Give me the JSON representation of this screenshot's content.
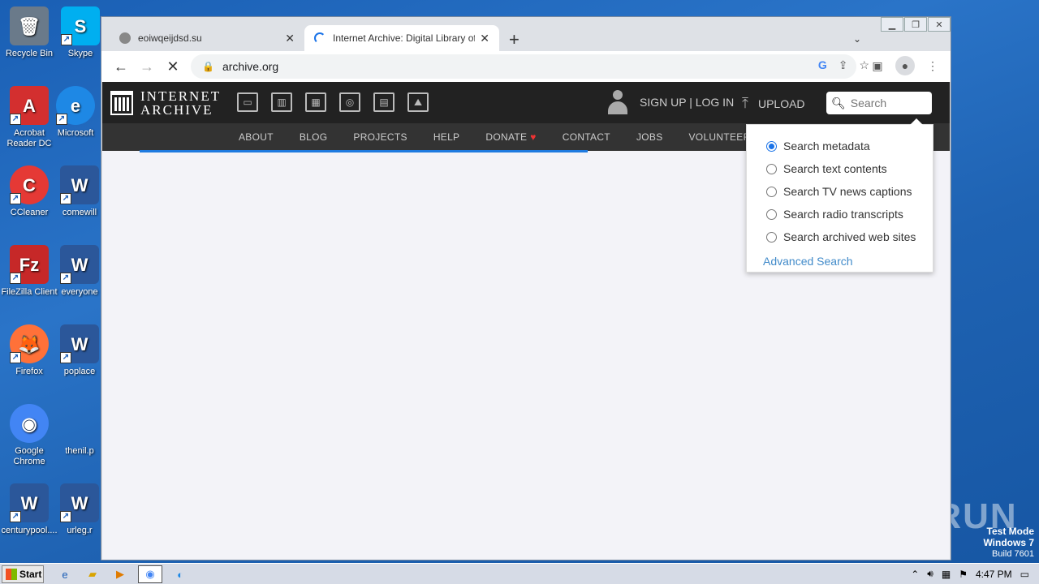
{
  "desktop": {
    "icons": [
      {
        "label": "Recycle Bin",
        "color": "#6a7a8a",
        "glyph": "🗑"
      },
      {
        "label": "Skype",
        "color": "#00aff0",
        "glyph": "S"
      },
      {
        "label": "Acrobat Reader DC",
        "color": "#d32f2f",
        "glyph": "A"
      },
      {
        "label": "Microsoft",
        "color": "#1e88e5",
        "glyph": "e"
      },
      {
        "label": "CCleaner",
        "color": "#e53935",
        "glyph": "C"
      },
      {
        "label": "comewill",
        "color": "#2b579a",
        "glyph": "W"
      },
      {
        "label": "FileZilla Client",
        "color": "#c62828",
        "glyph": "Fz"
      },
      {
        "label": "everyone",
        "color": "#2b579a",
        "glyph": "W"
      },
      {
        "label": "Firefox",
        "color": "#ff7139",
        "glyph": "🦊"
      },
      {
        "label": "poplace",
        "color": "#2b579a",
        "glyph": "W"
      },
      {
        "label": "Google Chrome",
        "color": "#4285f4",
        "glyph": "◉"
      },
      {
        "label": "thenil.p",
        "color": "#2b6cb0",
        "glyph": ""
      },
      {
        "label": "centurypool....",
        "color": "#2b579a",
        "glyph": "W"
      },
      {
        "label": "urleg.r",
        "color": "#2b579a",
        "glyph": "W"
      }
    ],
    "watermark": "ANY RUN",
    "test_mode": {
      "line1": "Test Mode",
      "line2": "Windows 7",
      "line3": "Build 7601"
    }
  },
  "browser": {
    "tabs": [
      {
        "title": "eoiwqeijdsd.su",
        "close": "✕"
      },
      {
        "title": "Internet Archive: Digital Library of Fr",
        "close": "✕"
      }
    ],
    "new_tab": "+",
    "url": "archive.org"
  },
  "ia": {
    "logo_line1": "INTERNET",
    "logo_line2": "ARCHIVE",
    "account": "SIGN UP | LOG IN",
    "upload": "UPLOAD",
    "search_placeholder": "Search",
    "subnav": [
      "ABOUT",
      "BLOG",
      "PROJECTS",
      "HELP",
      "DONATE",
      "CONTACT",
      "JOBS",
      "VOLUNTEER"
    ],
    "search_options": [
      {
        "label": "Search metadata",
        "checked": true
      },
      {
        "label": "Search text contents",
        "checked": false
      },
      {
        "label": "Search TV news captions",
        "checked": false
      },
      {
        "label": "Search radio transcripts",
        "checked": false
      },
      {
        "label": "Search archived web sites",
        "checked": false
      }
    ],
    "advanced_search": "Advanced Search"
  },
  "taskbar": {
    "start": "Start",
    "clock": "4:47 PM"
  }
}
